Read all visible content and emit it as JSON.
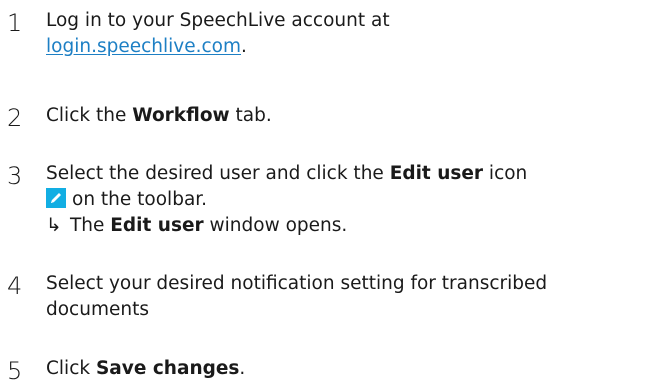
{
  "steps": [
    {
      "number": "1",
      "line1": "Log in to your SpeechLive account at",
      "link": "login.speechlive.com",
      "link_suffix": "."
    },
    {
      "number": "2",
      "pre": "Click the ",
      "bold": "Workflow",
      "post": " tab."
    },
    {
      "number": "3",
      "pre": "Select the desired user and click the ",
      "bold": "Edit user",
      "post": " icon",
      "line2": "on the toolbar.",
      "icon": "edit-pencil-icon",
      "result_arrow": "↳",
      "result_pre": "The ",
      "result_bold": "Edit user",
      "result_post": " window opens."
    },
    {
      "number": "4",
      "line1": "Select your desired notification setting for transcribed",
      "line2": "documents"
    },
    {
      "number": "5",
      "pre": "Click ",
      "bold": "Save changes",
      "post": "."
    }
  ],
  "colors": {
    "text": "#1a1a1a",
    "link": "#1d7fc4",
    "icon_bg": "#12aee3"
  }
}
